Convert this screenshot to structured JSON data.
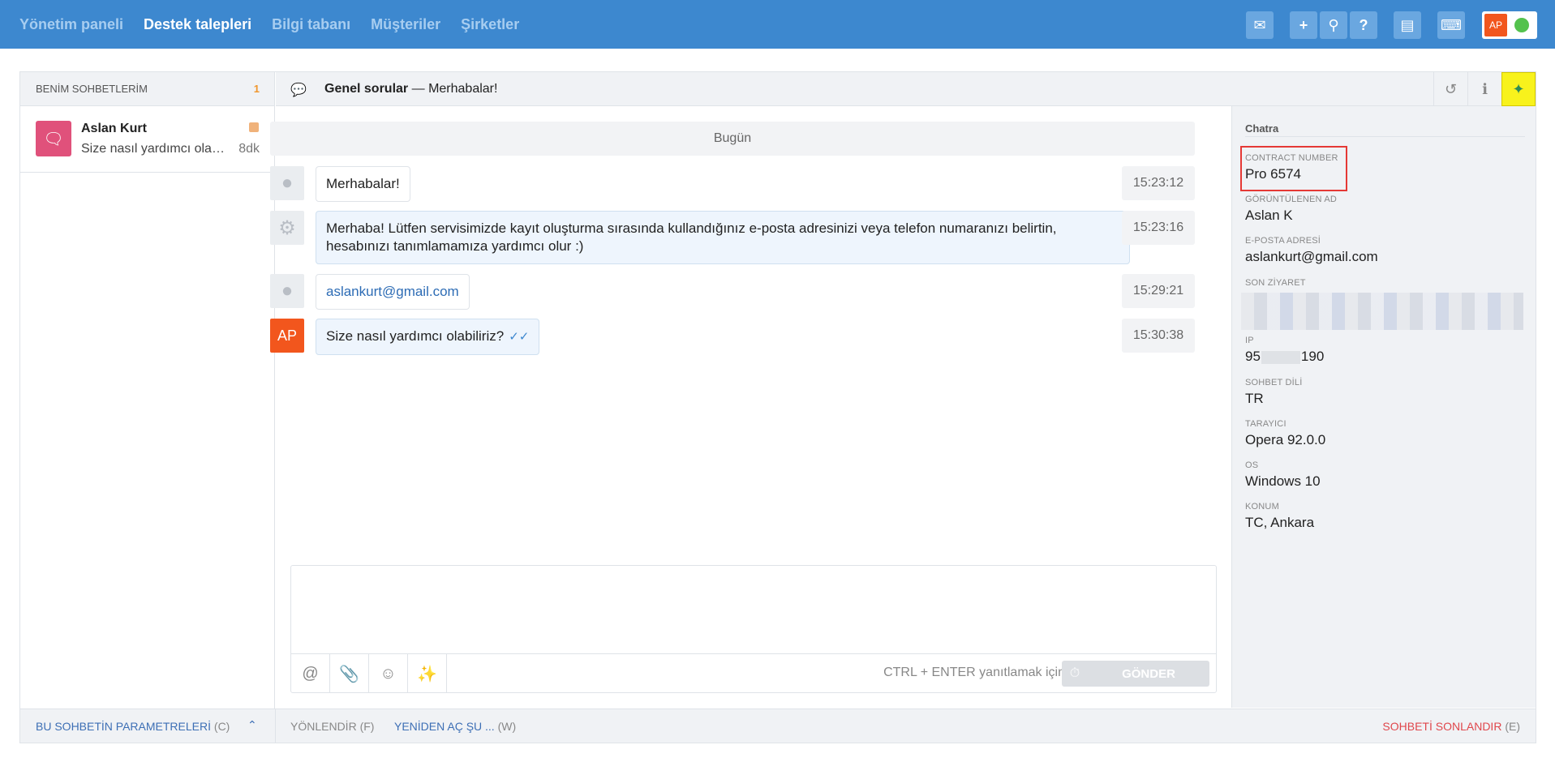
{
  "nav": {
    "items": [
      "Yönetim paneli",
      "Destek talepleri",
      "Bilgi tabanı",
      "Müşteriler",
      "Şirketler"
    ],
    "active_index": 1
  },
  "toolbar": {
    "icons": [
      "chat-icon",
      "plus-icon",
      "search-icon",
      "help-icon",
      "briefcase-icon",
      "keyboard-icon"
    ],
    "user_initials": "AP",
    "status_color": "#54c24d"
  },
  "left_panel": {
    "header": "BENİM SOHBETLERİM",
    "count": "1",
    "chats": [
      {
        "name": "Aslan Kurt",
        "preview": "Size nasıl yardımcı olabiliriz?",
        "time": "8dk"
      }
    ]
  },
  "chat_header": {
    "topic": "Genel sorular",
    "separator": "—",
    "subject": "Merhabalar!"
  },
  "messages": {
    "day": "Bugün",
    "items": [
      {
        "author": "visitor",
        "text": "Merhabalar!",
        "time": "15:23:12"
      },
      {
        "author": "bot",
        "text": "Merhaba! Lütfen servisimizde kayıt oluşturma sırasında kullandığınız e-posta adresinizi veya telefon numaranızı belirtin, hesabınızı tanımlamamıza yardımcı olur :)",
        "time": "15:23:16"
      },
      {
        "author": "visitor",
        "text": "aslankurt@gmail.com",
        "time": "15:29:21"
      },
      {
        "author": "agent",
        "initials": "AP",
        "text": "Size nasıl yardımcı olabiliriz?",
        "time": "15:30:38"
      }
    ]
  },
  "reply": {
    "hint": "CTRL + ENTER yanıtlamak için",
    "send_label": "GÖNDER",
    "icons": [
      "at-icon",
      "paperclip-icon",
      "smiley-icon",
      "magic-wand-icon"
    ]
  },
  "info": {
    "title": "Chatra",
    "fields": [
      {
        "label": "CONTRACT NUMBER",
        "value": "Pro 6574"
      },
      {
        "label": "GÖRÜNTÜLENEN AD",
        "value": "Aslan K"
      },
      {
        "label": "E-POSTA ADRESİ",
        "value": "aslankurt@gmail.com"
      },
      {
        "label": "SON ZİYARET",
        "value": ""
      },
      {
        "label": "IP",
        "value_prefix": "95",
        "value_suffix": "190"
      },
      {
        "label": "SOHBET DİLİ",
        "value": "TR"
      },
      {
        "label": "TARAYICI",
        "value": "Opera 92.0.0"
      },
      {
        "label": "OS",
        "value": "Windows 10"
      },
      {
        "label": "KONUM",
        "value": "TC, Ankara"
      }
    ]
  },
  "bottom": {
    "params": "BU SOHBETİN PARAMETRELERİ",
    "params_key": "(C)",
    "forward": "YÖNLENDİR",
    "forward_key": "(F)",
    "reopen": "YENİDEN AÇ ŞU ...",
    "reopen_key": "(W)",
    "end": "SOHBETİ SONLANDIR",
    "end_key": "(E)"
  },
  "colors": {
    "topbar": "#3d88cf",
    "agent_avatar": "#f2561d",
    "chat_icon": "#e0517b",
    "plugin_highlight": "#f8f21c",
    "end_link": "#e0474c"
  }
}
